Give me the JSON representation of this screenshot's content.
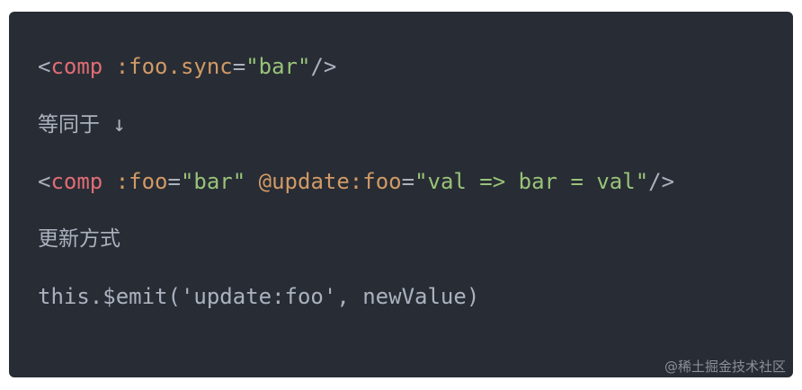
{
  "code": {
    "line1": {
      "lt": "<",
      "tag": "comp",
      "space": " ",
      "attr": ":foo.sync",
      "eq": "=",
      "value": "\"bar\"",
      "close": "/>"
    },
    "line2": {
      "text": "等同于",
      "arrow": " ↓"
    },
    "line3": {
      "lt": "<",
      "tag": "comp",
      "space1": " ",
      "attr1": ":foo",
      "eq1": "=",
      "value1": "\"bar\"",
      "space2": " ",
      "attr2": "@update:foo",
      "eq2": "=",
      "value2": "\"val => bar = val\"",
      "close": "/>"
    },
    "line4": {
      "text": "更新方式"
    },
    "line5": {
      "text": "this.$emit('update:foo', newValue)"
    }
  },
  "watermark": "@稀土掘金技术社区",
  "colors": {
    "background": "#282c34",
    "tag": "#e06c75",
    "attribute": "#d19a66",
    "string": "#98c379",
    "text": "#abb2bf"
  }
}
